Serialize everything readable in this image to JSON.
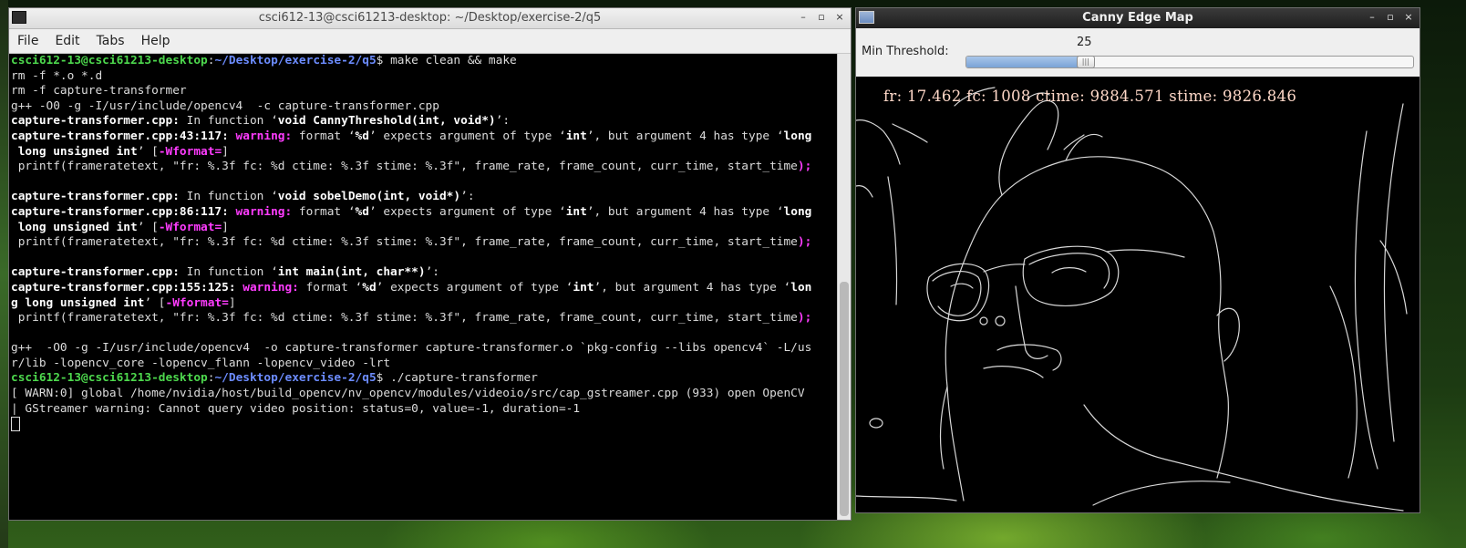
{
  "terminal": {
    "title": "csci612-13@csci61213-desktop: ~/Desktop/exercise-2/q5",
    "menu": [
      "File",
      "Edit",
      "Tabs",
      "Help"
    ],
    "lines": [
      [
        {
          "t": "csci612-13@csci61213-desktop",
          "c": "green"
        },
        {
          "t": ":",
          "c": "dim"
        },
        {
          "t": "~/Desktop/exercise-2/q5",
          "c": "blue"
        },
        {
          "t": "$ make clean && make",
          "c": "dim"
        }
      ],
      [
        {
          "t": "rm -f *.o *.d",
          "c": "dim"
        }
      ],
      [
        {
          "t": "rm -f capture-transformer",
          "c": "dim"
        }
      ],
      [
        {
          "t": "g++ -O0 -g -I/usr/include/opencv4  -c capture-transformer.cpp",
          "c": "dim"
        }
      ],
      [
        {
          "t": "capture-transformer.cpp:",
          "c": "white"
        },
        {
          "t": " In function ‘",
          "c": "dim"
        },
        {
          "t": "void CannyThreshold(int, void*)",
          "c": "white"
        },
        {
          "t": "’:",
          "c": "dim"
        }
      ],
      [
        {
          "t": "capture-transformer.cpp:43:117: ",
          "c": "white"
        },
        {
          "t": "warning: ",
          "c": "magenta"
        },
        {
          "t": "format ‘",
          "c": "dim"
        },
        {
          "t": "%d",
          "c": "white"
        },
        {
          "t": "’ expects argument of type ‘",
          "c": "dim"
        },
        {
          "t": "int",
          "c": "white"
        },
        {
          "t": "’, but argument 4 has type ‘",
          "c": "dim"
        },
        {
          "t": "long",
          "c": "white"
        }
      ],
      [
        {
          "t": " long unsigned int",
          "c": "white"
        },
        {
          "t": "’ [",
          "c": "dim"
        },
        {
          "t": "-Wformat=",
          "c": "magenta"
        },
        {
          "t": "]",
          "c": "dim"
        }
      ],
      [
        {
          "t": " printf(frameratetext, \"fr: %.3f fc: %d ctime: %.3f stime: %.3f\", frame_rate, frame_count, curr_time, start_time",
          "c": "dim"
        },
        {
          "t": ");",
          "c": "magenta"
        }
      ],
      [
        {
          "t": "                                                                                                                      ^",
          "c": "magenta"
        }
      ],
      [
        {
          "t": "capture-transformer.cpp:",
          "c": "white"
        },
        {
          "t": " In function ‘",
          "c": "dim"
        },
        {
          "t": "void sobelDemo(int, void*)",
          "c": "white"
        },
        {
          "t": "’:",
          "c": "dim"
        }
      ],
      [
        {
          "t": "capture-transformer.cpp:86:117: ",
          "c": "white"
        },
        {
          "t": "warning: ",
          "c": "magenta"
        },
        {
          "t": "format ‘",
          "c": "dim"
        },
        {
          "t": "%d",
          "c": "white"
        },
        {
          "t": "’ expects argument of type ‘",
          "c": "dim"
        },
        {
          "t": "int",
          "c": "white"
        },
        {
          "t": "’, but argument 4 has type ‘",
          "c": "dim"
        },
        {
          "t": "long",
          "c": "white"
        }
      ],
      [
        {
          "t": " long unsigned int",
          "c": "white"
        },
        {
          "t": "’ [",
          "c": "dim"
        },
        {
          "t": "-Wformat=",
          "c": "magenta"
        },
        {
          "t": "]",
          "c": "dim"
        }
      ],
      [
        {
          "t": " printf(frameratetext, \"fr: %.3f fc: %d ctime: %.3f stime: %.3f\", frame_rate, frame_count, curr_time, start_time",
          "c": "dim"
        },
        {
          "t": ");",
          "c": "magenta"
        }
      ],
      [
        {
          "t": "                                                                                                                      ^",
          "c": "magenta"
        }
      ],
      [
        {
          "t": "capture-transformer.cpp:",
          "c": "white"
        },
        {
          "t": " In function ‘",
          "c": "dim"
        },
        {
          "t": "int main(int, char**)",
          "c": "white"
        },
        {
          "t": "’:",
          "c": "dim"
        }
      ],
      [
        {
          "t": "capture-transformer.cpp:155:125: ",
          "c": "white"
        },
        {
          "t": "warning: ",
          "c": "magenta"
        },
        {
          "t": "format ‘",
          "c": "dim"
        },
        {
          "t": "%d",
          "c": "white"
        },
        {
          "t": "’ expects argument of type ‘",
          "c": "dim"
        },
        {
          "t": "int",
          "c": "white"
        },
        {
          "t": "’, but argument 4 has type ‘",
          "c": "dim"
        },
        {
          "t": "lon",
          "c": "white"
        }
      ],
      [
        {
          "t": "g long unsigned int",
          "c": "white"
        },
        {
          "t": "’ [",
          "c": "dim"
        },
        {
          "t": "-Wformat=",
          "c": "magenta"
        },
        {
          "t": "]",
          "c": "dim"
        }
      ],
      [
        {
          "t": " printf(frameratetext, \"fr: %.3f fc: %d ctime: %.3f stime: %.3f\", frame_rate, frame_count, curr_time, start_time",
          "c": "dim"
        },
        {
          "t": ");",
          "c": "magenta"
        }
      ],
      [
        {
          "t": "                                                                                                                      ^",
          "c": "magenta"
        }
      ],
      [
        {
          "t": "g++  -O0 -g -I/usr/include/opencv4  -o capture-transformer capture-transformer.o `pkg-config --libs opencv4` -L/us",
          "c": "dim"
        }
      ],
      [
        {
          "t": "r/lib -lopencv_core -lopencv_flann -lopencv_video -lrt",
          "c": "dim"
        }
      ],
      [
        {
          "t": "csci612-13@csci61213-desktop",
          "c": "green"
        },
        {
          "t": ":",
          "c": "dim"
        },
        {
          "t": "~/Desktop/exercise-2/q5",
          "c": "blue"
        },
        {
          "t": "$ ./capture-transformer",
          "c": "dim"
        }
      ],
      [
        {
          "t": "[ WARN:0] global /home/nvidia/host/build_opencv/nv_opencv/modules/videoio/src/cap_gstreamer.cpp (933) open OpenCV",
          "c": "dim"
        }
      ],
      [
        {
          "t": "| GStreamer warning: Cannot query video position: status=0, value=-1, duration=-1",
          "c": "dim"
        }
      ]
    ]
  },
  "canny": {
    "title": "Canny Edge Map",
    "trackbar_label": "Min Threshold:",
    "trackbar_value": "25",
    "trackbar_fraction": 0.265,
    "overlay_text": "fr: 17.462 fc: 1008 ctime: 9884.571 stime: 9826.846"
  },
  "window_buttons": {
    "minimize": "–",
    "maximize": "▫",
    "close": "×"
  }
}
